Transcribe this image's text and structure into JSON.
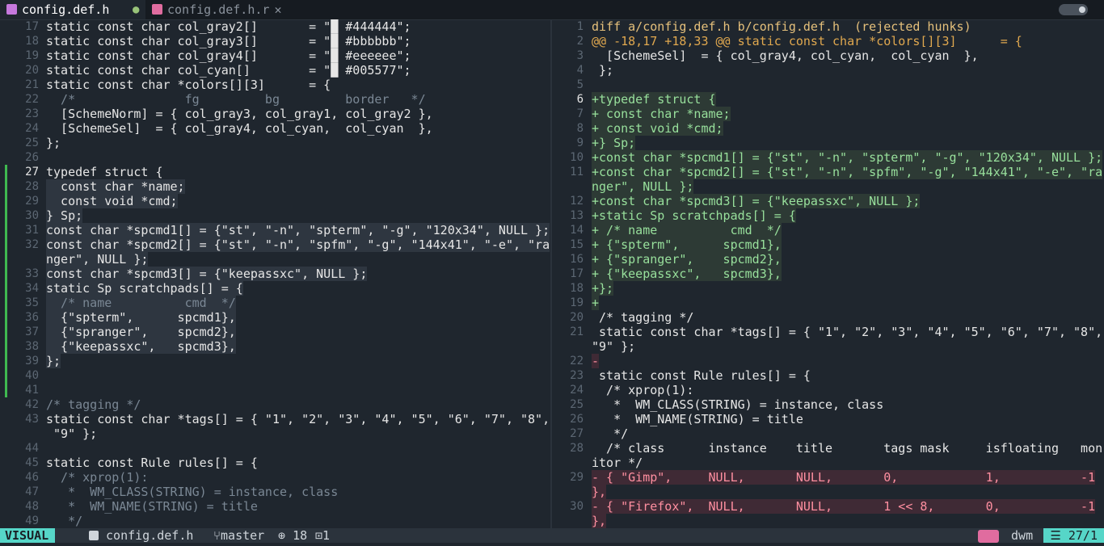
{
  "tabs": {
    "active": "config.def.h",
    "inactive": "config.def.h.r",
    "modified_marker": "●",
    "close": "✕"
  },
  "left_pane": {
    "lines": [
      {
        "n": "17",
        "t": "static const char col_gray2[]       = \"█ #444444\";"
      },
      {
        "n": "18",
        "t": "static const char col_gray3[]       = \"█ #bbbbbb\";"
      },
      {
        "n": "19",
        "t": "static const char col_gray4[]       = \"█ #eeeeee\";"
      },
      {
        "n": "20",
        "t": "static const char col_cyan[]        = \"█ #005577\";"
      },
      {
        "n": "21",
        "t": "static const char *colors[][3]      = {"
      },
      {
        "n": "22",
        "t": "  /*               fg         bg         border   */",
        "c": "cmt"
      },
      {
        "n": "23",
        "t": "  [SchemeNorm] = { col_gray3, col_gray1, col_gray2 },"
      },
      {
        "n": "24",
        "t": "  [SchemeSel]  = { col_gray4, col_cyan,  col_cyan  },"
      },
      {
        "n": "25",
        "t": "};"
      },
      {
        "n": "26",
        "t": ""
      },
      {
        "n": "27",
        "t": "typedef struct {",
        "cur": true,
        "sign": true
      },
      {
        "n": "28",
        "t": "  const char *name;",
        "sign": true,
        "vis": true
      },
      {
        "n": "29",
        "t": "  const void *cmd;",
        "sign": true,
        "vis": true
      },
      {
        "n": "30",
        "t": "} Sp;",
        "sign": true,
        "vis": true
      },
      {
        "n": "31",
        "t": "const char *spcmd1[] = {\"st\", \"-n\", \"spterm\", \"-g\", \"120x34\", NULL };",
        "sign": true,
        "vis": true
      },
      {
        "n": "32",
        "t": "const char *spcmd2[] = {\"st\", \"-n\", \"spfm\", \"-g\", \"144x41\", \"-e\", \"ra",
        "sign": true,
        "vis": true
      },
      {
        "n": "",
        "t": "nger\", NULL };",
        "sign": true,
        "vis": true
      },
      {
        "n": "33",
        "t": "const char *spcmd3[] = {\"keepassxc\", NULL };",
        "sign": true,
        "vis": true
      },
      {
        "n": "34",
        "t": "static Sp scratchpads[] = {",
        "sign": true,
        "vis": true
      },
      {
        "n": "35",
        "t": "  /* name          cmd  */",
        "sign": true,
        "vis": true,
        "c": "cmt"
      },
      {
        "n": "36",
        "t": "  {\"spterm\",      spcmd1},",
        "sign": true,
        "vis": true
      },
      {
        "n": "37",
        "t": "  {\"spranger\",    spcmd2},",
        "sign": true,
        "vis": true
      },
      {
        "n": "38",
        "t": "  {\"keepassxc\",   spcmd3},",
        "sign": true,
        "vis": true
      },
      {
        "n": "39",
        "t": "};",
        "sign": true,
        "vis": true
      },
      {
        "n": "40",
        "t": "",
        "sign": true
      },
      {
        "n": "41",
        "t": "",
        "sign": true
      },
      {
        "n": "42",
        "t": "/* tagging */",
        "c": "cmt"
      },
      {
        "n": "43",
        "t": "static const char *tags[] = { \"1\", \"2\", \"3\", \"4\", \"5\", \"6\", \"7\", \"8\","
      },
      {
        "n": "",
        "t": " \"9\" };"
      },
      {
        "n": "44",
        "t": ""
      },
      {
        "n": "45",
        "t": "static const Rule rules[] = {"
      },
      {
        "n": "46",
        "t": "  /* xprop(1):",
        "c": "cmt"
      },
      {
        "n": "47",
        "t": "   *  WM_CLASS(STRING) = instance, class",
        "c": "cmt"
      },
      {
        "n": "48",
        "t": "   *  WM_NAME(STRING) = title",
        "c": "cmt"
      },
      {
        "n": "49",
        "t": "   */",
        "c": "cmt"
      }
    ]
  },
  "right_pane": {
    "lines": [
      {
        "n": "1",
        "t": "diff a/config.def.h b/config.def.h  (rejected hunks)",
        "c": "diffhdr"
      },
      {
        "n": "2",
        "t": "@@ -18,17 +18,33 @@ static const char *colors[][3]      = {",
        "c": "hunkhdr"
      },
      {
        "n": "3",
        "t": "  [SchemeSel]  = { col_gray4, col_cyan,  col_cyan  },"
      },
      {
        "n": "4",
        "t": " };"
      },
      {
        "n": "5",
        "t": ""
      },
      {
        "n": "6",
        "t": "+typedef struct {",
        "c": "add",
        "cur": true
      },
      {
        "n": "7",
        "t": "+ const char *name;",
        "c": "add"
      },
      {
        "n": "8",
        "t": "+ const void *cmd;",
        "c": "add"
      },
      {
        "n": "9",
        "t": "+} Sp;",
        "c": "add"
      },
      {
        "n": "10",
        "t": "+const char *spcmd1[] = {\"st\", \"-n\", \"spterm\", \"-g\", \"120x34\", NULL };",
        "c": "add"
      },
      {
        "n": "11",
        "t": "+const char *spcmd2[] = {\"st\", \"-n\", \"spfm\", \"-g\", \"144x41\", \"-e\", \"ra",
        "c": "add"
      },
      {
        "n": "",
        "t": "nger\", NULL };",
        "c": "add"
      },
      {
        "n": "12",
        "t": "+const char *spcmd3[] = {\"keepassxc\", NULL };",
        "c": "add"
      },
      {
        "n": "13",
        "t": "+static Sp scratchpads[] = {",
        "c": "add"
      },
      {
        "n": "14",
        "t": "+ /* name          cmd  */",
        "c": "add"
      },
      {
        "n": "15",
        "t": "+ {\"spterm\",      spcmd1},",
        "c": "add"
      },
      {
        "n": "16",
        "t": "+ {\"spranger\",    spcmd2},",
        "c": "add"
      },
      {
        "n": "17",
        "t": "+ {\"keepassxc\",   spcmd3},",
        "c": "add"
      },
      {
        "n": "18",
        "t": "+};",
        "c": "add"
      },
      {
        "n": "19",
        "t": "+",
        "c": "add"
      },
      {
        "n": "20",
        "t": " /* tagging */"
      },
      {
        "n": "21",
        "t": " static const char *tags[] = { \"1\", \"2\", \"3\", \"4\", \"5\", \"6\", \"7\", \"8\","
      },
      {
        "n": "",
        "t": "\"9\" };"
      },
      {
        "n": "22",
        "t": "-",
        "c": "del"
      },
      {
        "n": "23",
        "t": " static const Rule rules[] = {"
      },
      {
        "n": "24",
        "t": "  /* xprop(1):"
      },
      {
        "n": "25",
        "t": "   *  WM_CLASS(STRING) = instance, class"
      },
      {
        "n": "26",
        "t": "   *  WM_NAME(STRING) = title"
      },
      {
        "n": "27",
        "t": "   */"
      },
      {
        "n": "28",
        "t": "  /* class      instance    title       tags mask     isfloating   mon"
      },
      {
        "n": "",
        "t": "itor */"
      },
      {
        "n": "29",
        "t": "- { \"Gimp\",     NULL,       NULL,       0,            1,           -1",
        "c": "del"
      },
      {
        "n": "",
        "t": "},",
        "c": "del"
      },
      {
        "n": "30",
        "t": "- { \"Firefox\",  NULL,       NULL,       1 << 8,       0,           -1",
        "c": "del"
      },
      {
        "n": "",
        "t": "},",
        "c": "del"
      }
    ]
  },
  "statusbar": {
    "mode": "VISUAL",
    "file": "config.def.h",
    "branch": "master",
    "added": "18",
    "changed": "1",
    "filetype": "dwm",
    "position": "27/1"
  },
  "colors": {
    "mode_bg": "#56d6c8",
    "add_fg": "#98e09c",
    "del_fg": "#ff8fa0",
    "sign": "#3fb950"
  }
}
